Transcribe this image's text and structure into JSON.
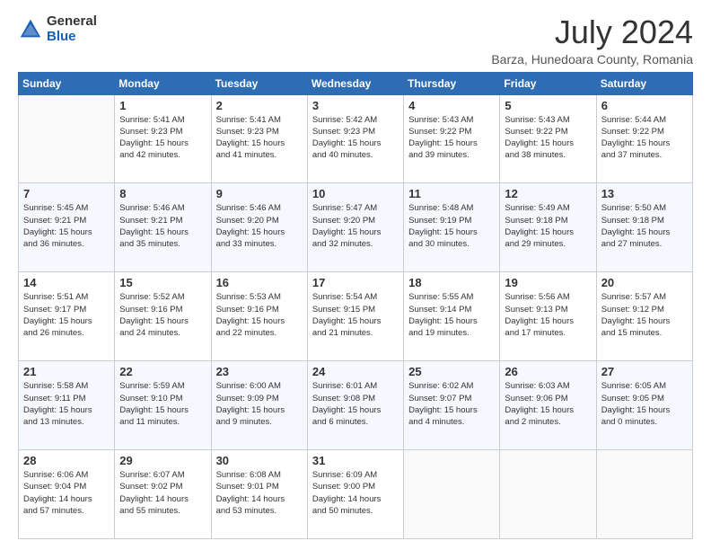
{
  "logo": {
    "general": "General",
    "blue": "Blue"
  },
  "title": {
    "month_year": "July 2024",
    "location": "Barza, Hunedoara County, Romania"
  },
  "weekdays": [
    "Sunday",
    "Monday",
    "Tuesday",
    "Wednesday",
    "Thursday",
    "Friday",
    "Saturday"
  ],
  "weeks": [
    [
      {
        "day": "",
        "info": ""
      },
      {
        "day": "1",
        "info": "Sunrise: 5:41 AM\nSunset: 9:23 PM\nDaylight: 15 hours\nand 42 minutes."
      },
      {
        "day": "2",
        "info": "Sunrise: 5:41 AM\nSunset: 9:23 PM\nDaylight: 15 hours\nand 41 minutes."
      },
      {
        "day": "3",
        "info": "Sunrise: 5:42 AM\nSunset: 9:23 PM\nDaylight: 15 hours\nand 40 minutes."
      },
      {
        "day": "4",
        "info": "Sunrise: 5:43 AM\nSunset: 9:22 PM\nDaylight: 15 hours\nand 39 minutes."
      },
      {
        "day": "5",
        "info": "Sunrise: 5:43 AM\nSunset: 9:22 PM\nDaylight: 15 hours\nand 38 minutes."
      },
      {
        "day": "6",
        "info": "Sunrise: 5:44 AM\nSunset: 9:22 PM\nDaylight: 15 hours\nand 37 minutes."
      }
    ],
    [
      {
        "day": "7",
        "info": "Sunrise: 5:45 AM\nSunset: 9:21 PM\nDaylight: 15 hours\nand 36 minutes."
      },
      {
        "day": "8",
        "info": "Sunrise: 5:46 AM\nSunset: 9:21 PM\nDaylight: 15 hours\nand 35 minutes."
      },
      {
        "day": "9",
        "info": "Sunrise: 5:46 AM\nSunset: 9:20 PM\nDaylight: 15 hours\nand 33 minutes."
      },
      {
        "day": "10",
        "info": "Sunrise: 5:47 AM\nSunset: 9:20 PM\nDaylight: 15 hours\nand 32 minutes."
      },
      {
        "day": "11",
        "info": "Sunrise: 5:48 AM\nSunset: 9:19 PM\nDaylight: 15 hours\nand 30 minutes."
      },
      {
        "day": "12",
        "info": "Sunrise: 5:49 AM\nSunset: 9:18 PM\nDaylight: 15 hours\nand 29 minutes."
      },
      {
        "day": "13",
        "info": "Sunrise: 5:50 AM\nSunset: 9:18 PM\nDaylight: 15 hours\nand 27 minutes."
      }
    ],
    [
      {
        "day": "14",
        "info": "Sunrise: 5:51 AM\nSunset: 9:17 PM\nDaylight: 15 hours\nand 26 minutes."
      },
      {
        "day": "15",
        "info": "Sunrise: 5:52 AM\nSunset: 9:16 PM\nDaylight: 15 hours\nand 24 minutes."
      },
      {
        "day": "16",
        "info": "Sunrise: 5:53 AM\nSunset: 9:16 PM\nDaylight: 15 hours\nand 22 minutes."
      },
      {
        "day": "17",
        "info": "Sunrise: 5:54 AM\nSunset: 9:15 PM\nDaylight: 15 hours\nand 21 minutes."
      },
      {
        "day": "18",
        "info": "Sunrise: 5:55 AM\nSunset: 9:14 PM\nDaylight: 15 hours\nand 19 minutes."
      },
      {
        "day": "19",
        "info": "Sunrise: 5:56 AM\nSunset: 9:13 PM\nDaylight: 15 hours\nand 17 minutes."
      },
      {
        "day": "20",
        "info": "Sunrise: 5:57 AM\nSunset: 9:12 PM\nDaylight: 15 hours\nand 15 minutes."
      }
    ],
    [
      {
        "day": "21",
        "info": "Sunrise: 5:58 AM\nSunset: 9:11 PM\nDaylight: 15 hours\nand 13 minutes."
      },
      {
        "day": "22",
        "info": "Sunrise: 5:59 AM\nSunset: 9:10 PM\nDaylight: 15 hours\nand 11 minutes."
      },
      {
        "day": "23",
        "info": "Sunrise: 6:00 AM\nSunset: 9:09 PM\nDaylight: 15 hours\nand 9 minutes."
      },
      {
        "day": "24",
        "info": "Sunrise: 6:01 AM\nSunset: 9:08 PM\nDaylight: 15 hours\nand 6 minutes."
      },
      {
        "day": "25",
        "info": "Sunrise: 6:02 AM\nSunset: 9:07 PM\nDaylight: 15 hours\nand 4 minutes."
      },
      {
        "day": "26",
        "info": "Sunrise: 6:03 AM\nSunset: 9:06 PM\nDaylight: 15 hours\nand 2 minutes."
      },
      {
        "day": "27",
        "info": "Sunrise: 6:05 AM\nSunset: 9:05 PM\nDaylight: 15 hours\nand 0 minutes."
      }
    ],
    [
      {
        "day": "28",
        "info": "Sunrise: 6:06 AM\nSunset: 9:04 PM\nDaylight: 14 hours\nand 57 minutes."
      },
      {
        "day": "29",
        "info": "Sunrise: 6:07 AM\nSunset: 9:02 PM\nDaylight: 14 hours\nand 55 minutes."
      },
      {
        "day": "30",
        "info": "Sunrise: 6:08 AM\nSunset: 9:01 PM\nDaylight: 14 hours\nand 53 minutes."
      },
      {
        "day": "31",
        "info": "Sunrise: 6:09 AM\nSunset: 9:00 PM\nDaylight: 14 hours\nand 50 minutes."
      },
      {
        "day": "",
        "info": ""
      },
      {
        "day": "",
        "info": ""
      },
      {
        "day": "",
        "info": ""
      }
    ]
  ]
}
